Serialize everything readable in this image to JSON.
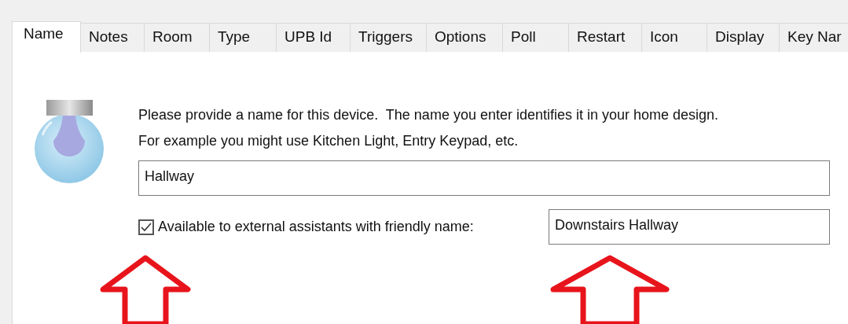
{
  "tabs": [
    {
      "label": "Name",
      "selected": true
    },
    {
      "label": "Notes",
      "selected": false
    },
    {
      "label": "Room",
      "selected": false
    },
    {
      "label": "Type",
      "selected": false
    },
    {
      "label": "UPB Id",
      "selected": false
    },
    {
      "label": "Triggers",
      "selected": false
    },
    {
      "label": "Options",
      "selected": false
    },
    {
      "label": "Poll",
      "selected": false
    },
    {
      "label": "Restart",
      "selected": false
    },
    {
      "label": "Icon",
      "selected": false
    },
    {
      "label": "Display",
      "selected": false
    },
    {
      "label": "Key Nar",
      "selected": false
    }
  ],
  "instructions": [
    "Please provide a name for this device.  The name you enter identifies it in your home design.",
    "For example you might use Kitchen Light, Entry Keypad, etc."
  ],
  "name_field": {
    "value": "Hallway"
  },
  "assistant_option": {
    "label": "Available to external assistants with friendly name:",
    "checked": true
  },
  "friendly_name_field": {
    "value": "Downstairs Hallway"
  }
}
